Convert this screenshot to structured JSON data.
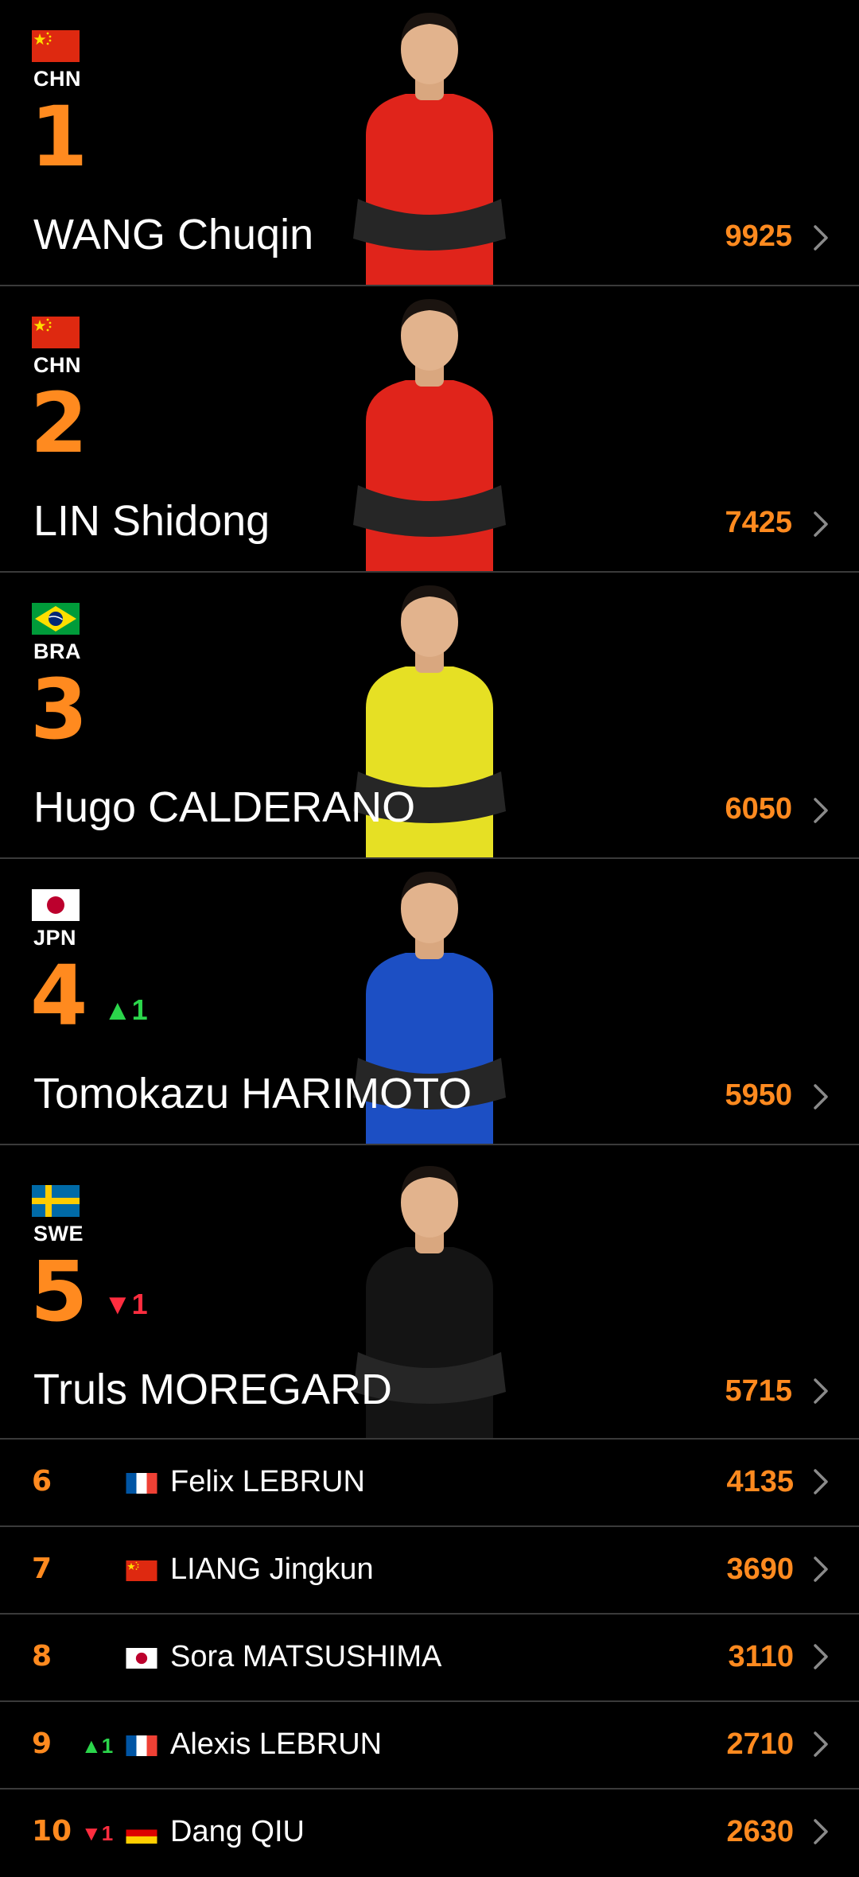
{
  "top": [
    {
      "rank": "1",
      "country": "CHN",
      "flag": "china-flag",
      "name": "WANG Chuqin",
      "points": "9925",
      "move": "",
      "move_dir": "",
      "jersey": "#e0241b"
    },
    {
      "rank": "2",
      "country": "CHN",
      "flag": "china-flag",
      "name": "LIN Shidong",
      "points": "7425",
      "move": "",
      "move_dir": "",
      "jersey": "#e0241b"
    },
    {
      "rank": "3",
      "country": "BRA",
      "flag": "brazil-flag",
      "name": "Hugo CALDERANO",
      "points": "6050",
      "move": "",
      "move_dir": "",
      "jersey": "#e6e024"
    },
    {
      "rank": "4",
      "country": "JPN",
      "flag": "japan-flag",
      "name": "Tomokazu HARIMOTO",
      "points": "5950",
      "move": "1",
      "move_dir": "up",
      "jersey": "#1c4fc4"
    },
    {
      "rank": "5",
      "country": "SWE",
      "flag": "sweden-flag",
      "name": "Truls MOREGARD",
      "points": "5715",
      "move": "1",
      "move_dir": "down",
      "jersey": "#141414"
    }
  ],
  "rows": [
    {
      "rank": "6",
      "flag": "france-flag",
      "name": "Felix LEBRUN",
      "points": "4135",
      "move": "",
      "move_dir": ""
    },
    {
      "rank": "7",
      "flag": "china-flag",
      "name": "LIANG Jingkun",
      "points": "3690",
      "move": "",
      "move_dir": ""
    },
    {
      "rank": "8",
      "flag": "japan-flag",
      "name": "Sora MATSUSHIMA",
      "points": "3110",
      "move": "",
      "move_dir": ""
    },
    {
      "rank": "9",
      "flag": "france-flag",
      "name": "Alexis LEBRUN",
      "points": "2710",
      "move": "1",
      "move_dir": "up"
    },
    {
      "rank": "10",
      "flag": "germany-flag",
      "name": "Dang QIU",
      "points": "2630",
      "move": "1",
      "move_dir": "down"
    }
  ],
  "colors": {
    "accent": "#ff8a1f",
    "up": "#2bd64b",
    "down": "#ff2d3f",
    "background": "#000000",
    "divider": "#3a3a3a"
  }
}
